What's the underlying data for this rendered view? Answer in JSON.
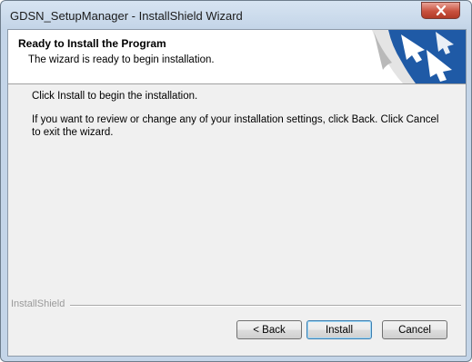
{
  "window": {
    "title": "GDSN_SetupManager - InstallShield Wizard"
  },
  "banner": {
    "title": "Ready to Install the Program",
    "subtitle": "The wizard is ready to begin installation."
  },
  "body": {
    "line1": "Click Install to begin the installation.",
    "line2": "If you want to review or change any of your installation settings, click Back. Click Cancel to exit the wizard."
  },
  "footer": {
    "brand": "InstallShield"
  },
  "buttons": {
    "back": "< Back",
    "install": "Install",
    "cancel": "Cancel"
  },
  "icons": {
    "close": "close-icon",
    "banner_graphic": "installshield-banner-graphic"
  },
  "colors": {
    "accent_blue": "#1f5aa6",
    "close_red": "#c9523f"
  }
}
